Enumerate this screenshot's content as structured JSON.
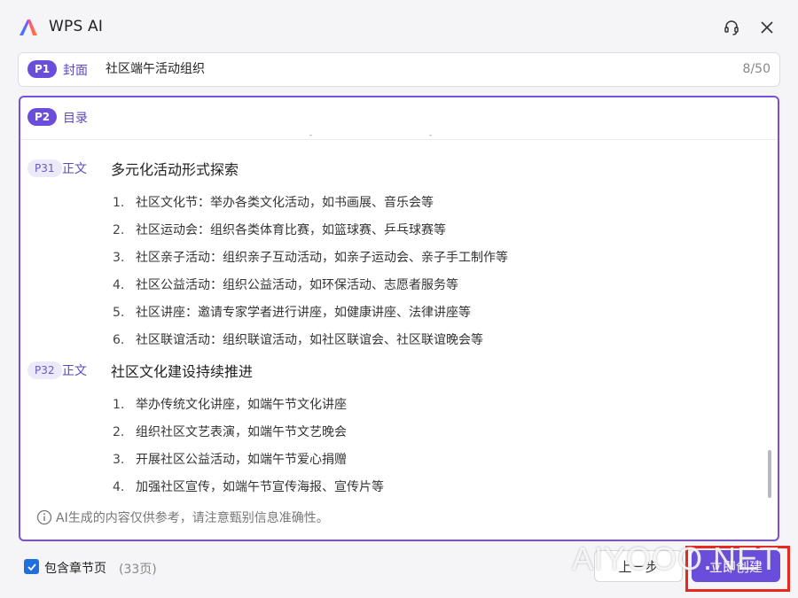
{
  "window": {
    "title": "WPS AI"
  },
  "cover": {
    "badge": "P1",
    "label": "封面",
    "value": "社区端午活动组织",
    "char_count": "8/50"
  },
  "toc": {
    "badge": "P2",
    "label": "目录"
  },
  "sections": [
    {
      "badge": "P31",
      "label": "正文",
      "title": "多元化活动形式探索",
      "items": [
        {
          "num": "1.",
          "text": "社区文化节：举办各类文化活动，如书画展、音乐会等"
        },
        {
          "num": "2.",
          "text": "社区运动会：组织各类体育比赛，如篮球赛、乒乓球赛等"
        },
        {
          "num": "3.",
          "text": "社区亲子活动：组织亲子互动活动，如亲子运动会、亲子手工制作等"
        },
        {
          "num": "4.",
          "text": "社区公益活动：组织公益活动，如环保活动、志愿者服务等"
        },
        {
          "num": "5.",
          "text": "社区讲座：邀请专家学者进行讲座，如健康讲座、法律讲座等"
        },
        {
          "num": "6.",
          "text": "社区联谊活动：组织联谊活动，如社区联谊会、社区联谊晚会等"
        }
      ]
    },
    {
      "badge": "P32",
      "label": "正文",
      "title": "社区文化建设持续推进",
      "items": [
        {
          "num": "1.",
          "text": "举办传统文化讲座，如端午节文化讲座"
        },
        {
          "num": "2.",
          "text": "组织社区文艺表演，如端午节文艺晚会"
        },
        {
          "num": "3.",
          "text": "开展社区公益活动，如端午节爱心捐赠"
        },
        {
          "num": "4.",
          "text": "加强社区宣传，如端午节宣传海报、宣传片等"
        }
      ]
    }
  ],
  "note": "AI生成的内容仅供参考，请注意甄别信息准确性。",
  "footer": {
    "checkbox_label": "包含章节页",
    "checkbox_checked": true,
    "page_count": "(33页)",
    "prev_button": "上一步",
    "create_button": "立即创建"
  },
  "watermark": "AIYOOO.NET",
  "colors": {
    "accent": "#6a4ddb",
    "highlight": "#e8281e",
    "checkbox": "#1f6fdc"
  }
}
